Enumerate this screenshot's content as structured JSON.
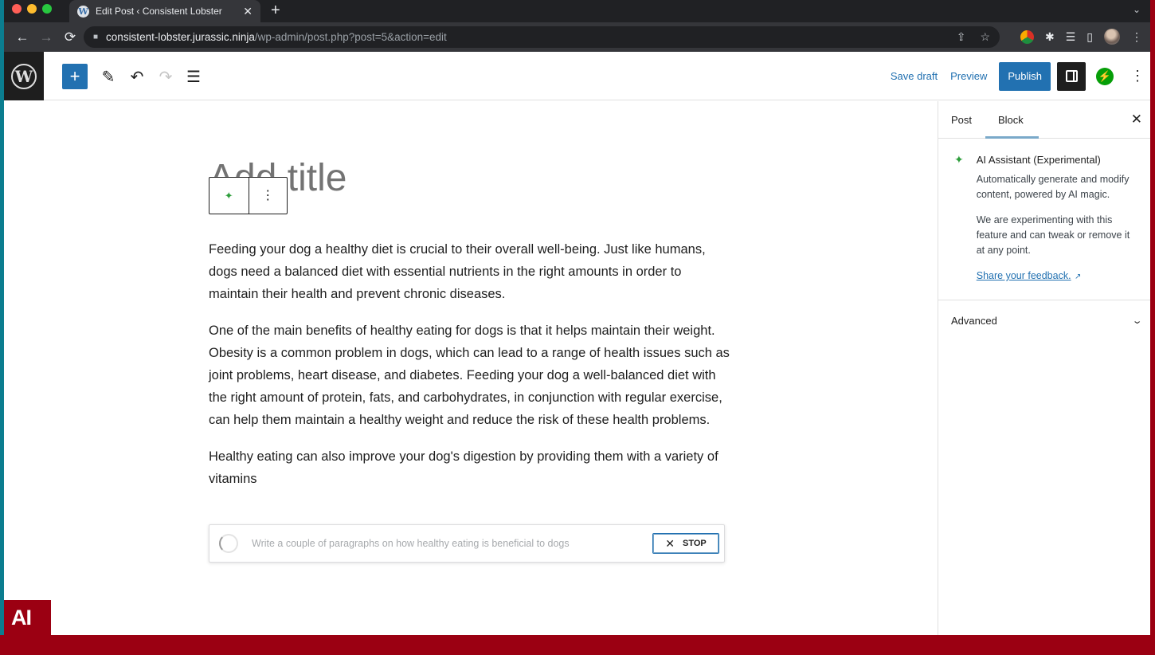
{
  "browser": {
    "tab_title": "Edit Post ‹ Consistent Lobster",
    "tab_favicon": "W",
    "url_host": "consistent-lobster.jurassic.ninja",
    "url_path": "/wp-admin/post.php?post=5&action=edit",
    "icons": {
      "back": "←",
      "forward": "→",
      "reload": "⟳",
      "lock": "🔒",
      "share": "⇪",
      "bookmark": "☆",
      "extensions": "✱",
      "media": "☰",
      "sidepanel": "▯",
      "menu": "⋮",
      "close": "✕",
      "new_tab": "+",
      "dropdown": "⌄"
    }
  },
  "editor": {
    "toolbar": {
      "inserter": "+",
      "edit": "✎",
      "undo": "↶",
      "redo": "↷",
      "list_view": "☰"
    },
    "header_actions": {
      "save_draft": "Save draft",
      "preview": "Preview",
      "publish": "Publish",
      "jetpack": "⚡",
      "more": "⋮"
    },
    "title_placeholder": "Add title",
    "block_toolbar": {
      "ai_icon": "✦",
      "options": "⋮"
    },
    "paragraphs": [
      "Feeding your dog a healthy diet is crucial to their overall well-being. Just like humans, dogs need a balanced diet with essential nutrients in the right amounts in order to maintain their health and prevent chronic diseases.",
      "One of the main benefits of healthy eating for dogs is that it helps maintain their weight. Obesity is a common problem in dogs, which can lead to a range of health issues such as joint problems, heart disease, and diabetes. Feeding your dog a well-balanced diet with the right amount of protein, fats, and carbohydrates, in conjunction with regular exercise, can help them maintain a healthy weight and reduce the risk of these health problems.",
      "Healthy eating can also improve your dog's digestion by providing them with a variety of vitamins"
    ],
    "ai_prompt": {
      "text": "Write a couple of paragraphs on how healthy eating is beneficial to dogs",
      "stop_icon": "✕",
      "stop_label": "STOP"
    }
  },
  "sidebar": {
    "tabs": [
      {
        "label": "Post",
        "active": false
      },
      {
        "label": "Block",
        "active": true
      }
    ],
    "close_icon": "✕",
    "block_card": {
      "icon": "✦",
      "title": "AI Assistant (Experimental)",
      "description": "Automatically generate and modify content, powered by AI magic.",
      "note": "We are experimenting with this feature and can tweak or remove it at any point.",
      "link": "Share your feedback.",
      "link_icon": "↗"
    },
    "panels": [
      {
        "label": "Advanced",
        "icon": "⌄"
      }
    ]
  },
  "overlay": {
    "badge": "AI"
  },
  "colors": {
    "wp_blue": "#2271b1",
    "ai_green": "#2e9e3c",
    "jetpack_green": "#069e08",
    "frame_red": "#9b0012",
    "frame_teal": "#0b7d8f"
  }
}
